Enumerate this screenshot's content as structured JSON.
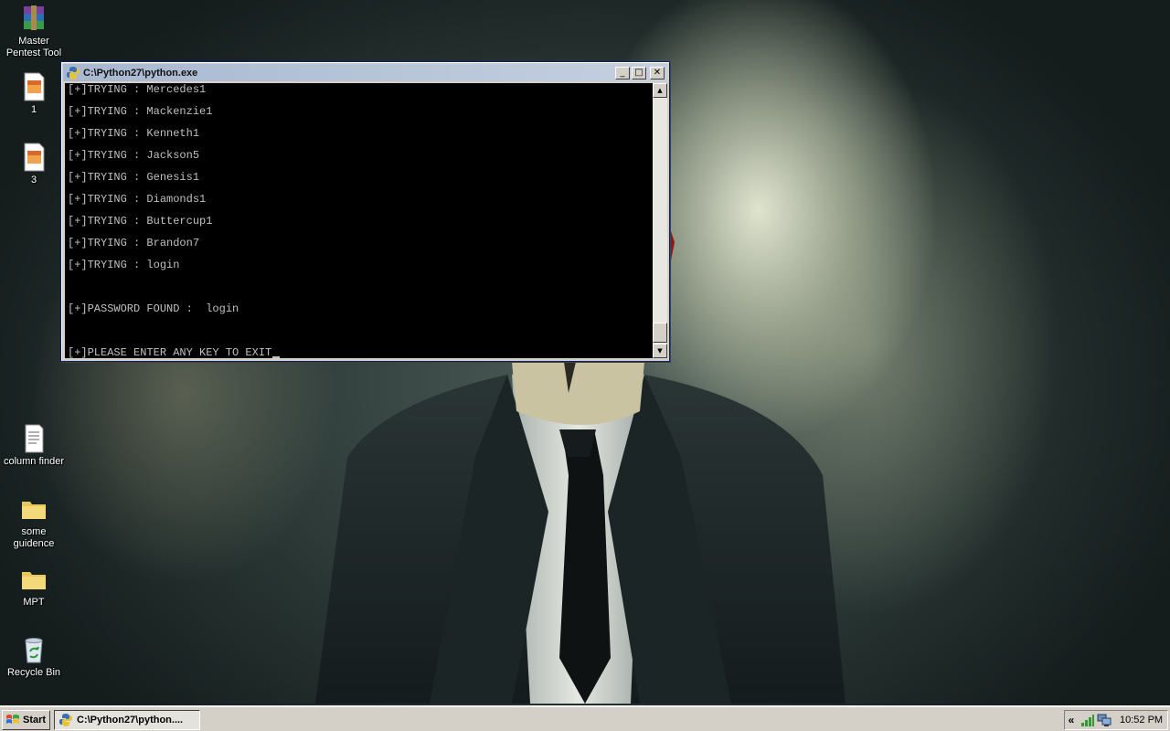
{
  "desktop": {
    "icons": [
      {
        "label": "Master\nPentest Tool",
        "icon": "winrar-archive-icon"
      },
      {
        "label": "1",
        "icon": "image-file-icon"
      },
      {
        "label": "3",
        "icon": "image-file-icon"
      },
      {
        "label": "column finder",
        "icon": "text-document-icon"
      },
      {
        "label": "some guidence",
        "icon": "folder-icon"
      },
      {
        "label": "MPT",
        "icon": "folder-icon"
      },
      {
        "label": "Recycle Bin",
        "icon": "recycle-bin-icon"
      }
    ]
  },
  "window": {
    "title": "C:\\Python27\\python.exe",
    "console_lines": [
      "[+]TRYING : Mercedes1",
      "[+]TRYING : Mackenzie1",
      "[+]TRYING : Kenneth1",
      "[+]TRYING : Jackson5",
      "[+]TRYING : Genesis1",
      "[+]TRYING : Diamonds1",
      "[+]TRYING : Buttercup1",
      "[+]TRYING : Brandon7",
      "[+]TRYING : login",
      "",
      "[+]PASSWORD FOUND :  login",
      "",
      "[+]PLEASE ENTER ANY KEY TO EXIT"
    ],
    "colors": {
      "console_bg": "#000000",
      "console_fg": "#c0c0c0",
      "titlebar": "#a8b8d0"
    }
  },
  "taskbar": {
    "start_label": "Start",
    "task_label": "C:\\Python27\\python....",
    "tray_expand": "«",
    "clock": "10:52 PM"
  }
}
